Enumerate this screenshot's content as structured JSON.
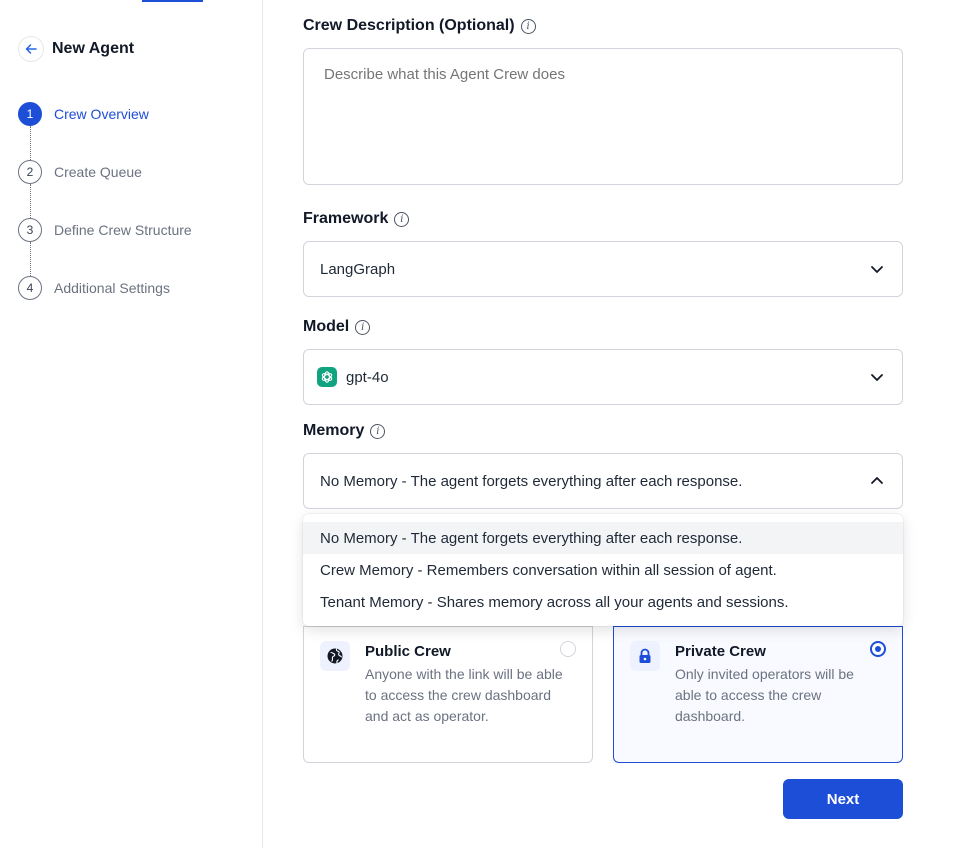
{
  "sidebar": {
    "back_title": "New Agent",
    "steps": [
      {
        "number": "1",
        "label": "Crew Overview"
      },
      {
        "number": "2",
        "label": "Create Queue"
      },
      {
        "number": "3",
        "label": "Define Crew Structure"
      },
      {
        "number": "4",
        "label": "Additional Settings"
      }
    ],
    "active_step": 1
  },
  "form": {
    "description": {
      "label": "Crew Description (Optional)",
      "placeholder": "Describe what this Agent Crew does",
      "value": ""
    },
    "framework": {
      "label": "Framework",
      "value": "LangGraph"
    },
    "model": {
      "label": "Model",
      "value": "gpt-4o",
      "icon": "openai-logo-icon"
    },
    "memory": {
      "label": "Memory",
      "value": "No Memory - The agent forgets everything after each response.",
      "options": [
        "No Memory - The agent forgets everything after each response.",
        "Crew Memory - Remembers conversation within all session of agent.",
        "Tenant Memory - Shares memory across all your agents and sessions."
      ]
    },
    "visibility": {
      "public": {
        "title": "Public Crew",
        "description": "Anyone with the link will be able to access the crew dashboard and act as operator.",
        "icon": "globe-icon",
        "selected": false
      },
      "private": {
        "title": "Private Crew",
        "description": "Only invited operators will be able to access the crew dashboard.",
        "icon": "lock-icon",
        "selected": true
      }
    },
    "next_label": "Next"
  },
  "colors": {
    "accent": "#1d4ed8",
    "model_logo": "#10a37f"
  }
}
